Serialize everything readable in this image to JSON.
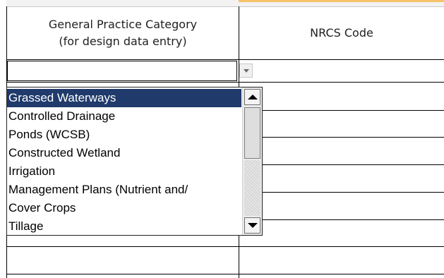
{
  "spreadsheet": {
    "columns": [
      {
        "header_line1": "General Practice Category",
        "header_line2": "(for design data entry)"
      },
      {
        "header": "NRCS Code"
      }
    ]
  },
  "dropdown": {
    "items": [
      {
        "label": "Grassed Waterways",
        "selected": true
      },
      {
        "label": "Controlled Drainage",
        "selected": false
      },
      {
        "label": "Ponds (WCSB)",
        "selected": false
      },
      {
        "label": "Constructed Wetland",
        "selected": false
      },
      {
        "label": "Irrigation",
        "selected": false
      },
      {
        "label": "Management Plans (Nutrient and/",
        "selected": false
      },
      {
        "label": "Cover Crops",
        "selected": false
      },
      {
        "label": "Tillage",
        "selected": false
      }
    ],
    "icons": {
      "open_button": "chevron-down-icon",
      "scroll_up": "arrow-up-icon",
      "scroll_down": "arrow-down-icon"
    }
  },
  "colors": {
    "selection_bg": "#1f3a6b",
    "selection_text": "#ffffff",
    "grid": "#000000",
    "column_top_accent": "#f6c36a"
  }
}
